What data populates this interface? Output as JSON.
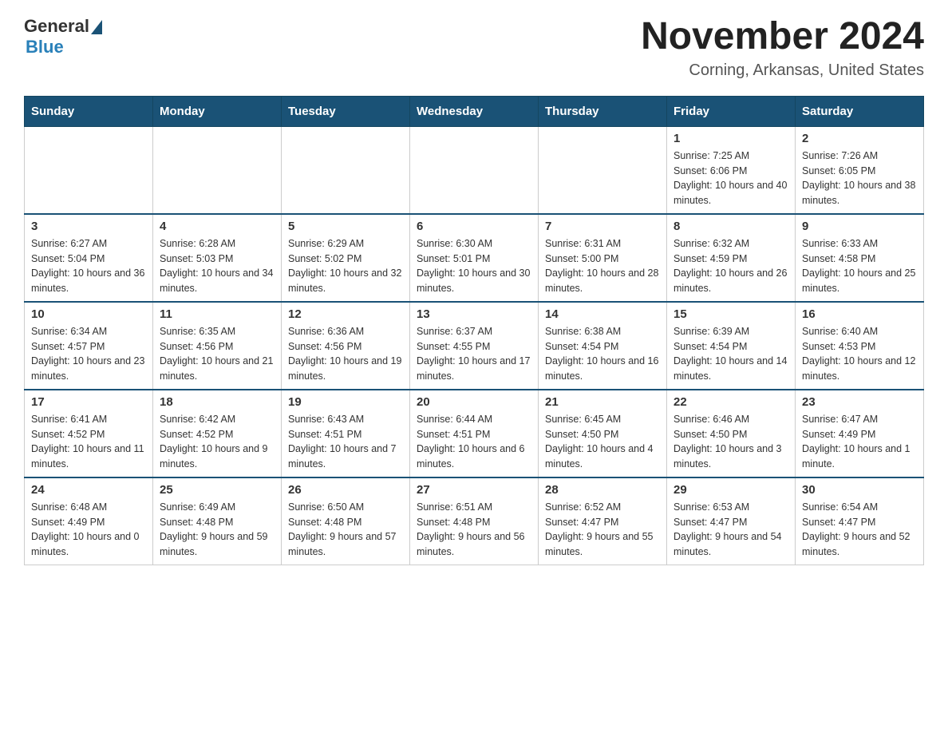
{
  "logo": {
    "general": "General",
    "blue": "Blue"
  },
  "title": "November 2024",
  "subtitle": "Corning, Arkansas, United States",
  "days_of_week": [
    "Sunday",
    "Monday",
    "Tuesday",
    "Wednesday",
    "Thursday",
    "Friday",
    "Saturday"
  ],
  "weeks": [
    [
      {
        "day": "",
        "info": ""
      },
      {
        "day": "",
        "info": ""
      },
      {
        "day": "",
        "info": ""
      },
      {
        "day": "",
        "info": ""
      },
      {
        "day": "",
        "info": ""
      },
      {
        "day": "1",
        "info": "Sunrise: 7:25 AM\nSunset: 6:06 PM\nDaylight: 10 hours and 40 minutes."
      },
      {
        "day": "2",
        "info": "Sunrise: 7:26 AM\nSunset: 6:05 PM\nDaylight: 10 hours and 38 minutes."
      }
    ],
    [
      {
        "day": "3",
        "info": "Sunrise: 6:27 AM\nSunset: 5:04 PM\nDaylight: 10 hours and 36 minutes."
      },
      {
        "day": "4",
        "info": "Sunrise: 6:28 AM\nSunset: 5:03 PM\nDaylight: 10 hours and 34 minutes."
      },
      {
        "day": "5",
        "info": "Sunrise: 6:29 AM\nSunset: 5:02 PM\nDaylight: 10 hours and 32 minutes."
      },
      {
        "day": "6",
        "info": "Sunrise: 6:30 AM\nSunset: 5:01 PM\nDaylight: 10 hours and 30 minutes."
      },
      {
        "day": "7",
        "info": "Sunrise: 6:31 AM\nSunset: 5:00 PM\nDaylight: 10 hours and 28 minutes."
      },
      {
        "day": "8",
        "info": "Sunrise: 6:32 AM\nSunset: 4:59 PM\nDaylight: 10 hours and 26 minutes."
      },
      {
        "day": "9",
        "info": "Sunrise: 6:33 AM\nSunset: 4:58 PM\nDaylight: 10 hours and 25 minutes."
      }
    ],
    [
      {
        "day": "10",
        "info": "Sunrise: 6:34 AM\nSunset: 4:57 PM\nDaylight: 10 hours and 23 minutes."
      },
      {
        "day": "11",
        "info": "Sunrise: 6:35 AM\nSunset: 4:56 PM\nDaylight: 10 hours and 21 minutes."
      },
      {
        "day": "12",
        "info": "Sunrise: 6:36 AM\nSunset: 4:56 PM\nDaylight: 10 hours and 19 minutes."
      },
      {
        "day": "13",
        "info": "Sunrise: 6:37 AM\nSunset: 4:55 PM\nDaylight: 10 hours and 17 minutes."
      },
      {
        "day": "14",
        "info": "Sunrise: 6:38 AM\nSunset: 4:54 PM\nDaylight: 10 hours and 16 minutes."
      },
      {
        "day": "15",
        "info": "Sunrise: 6:39 AM\nSunset: 4:54 PM\nDaylight: 10 hours and 14 minutes."
      },
      {
        "day": "16",
        "info": "Sunrise: 6:40 AM\nSunset: 4:53 PM\nDaylight: 10 hours and 12 minutes."
      }
    ],
    [
      {
        "day": "17",
        "info": "Sunrise: 6:41 AM\nSunset: 4:52 PM\nDaylight: 10 hours and 11 minutes."
      },
      {
        "day": "18",
        "info": "Sunrise: 6:42 AM\nSunset: 4:52 PM\nDaylight: 10 hours and 9 minutes."
      },
      {
        "day": "19",
        "info": "Sunrise: 6:43 AM\nSunset: 4:51 PM\nDaylight: 10 hours and 7 minutes."
      },
      {
        "day": "20",
        "info": "Sunrise: 6:44 AM\nSunset: 4:51 PM\nDaylight: 10 hours and 6 minutes."
      },
      {
        "day": "21",
        "info": "Sunrise: 6:45 AM\nSunset: 4:50 PM\nDaylight: 10 hours and 4 minutes."
      },
      {
        "day": "22",
        "info": "Sunrise: 6:46 AM\nSunset: 4:50 PM\nDaylight: 10 hours and 3 minutes."
      },
      {
        "day": "23",
        "info": "Sunrise: 6:47 AM\nSunset: 4:49 PM\nDaylight: 10 hours and 1 minute."
      }
    ],
    [
      {
        "day": "24",
        "info": "Sunrise: 6:48 AM\nSunset: 4:49 PM\nDaylight: 10 hours and 0 minutes."
      },
      {
        "day": "25",
        "info": "Sunrise: 6:49 AM\nSunset: 4:48 PM\nDaylight: 9 hours and 59 minutes."
      },
      {
        "day": "26",
        "info": "Sunrise: 6:50 AM\nSunset: 4:48 PM\nDaylight: 9 hours and 57 minutes."
      },
      {
        "day": "27",
        "info": "Sunrise: 6:51 AM\nSunset: 4:48 PM\nDaylight: 9 hours and 56 minutes."
      },
      {
        "day": "28",
        "info": "Sunrise: 6:52 AM\nSunset: 4:47 PM\nDaylight: 9 hours and 55 minutes."
      },
      {
        "day": "29",
        "info": "Sunrise: 6:53 AM\nSunset: 4:47 PM\nDaylight: 9 hours and 54 minutes."
      },
      {
        "day": "30",
        "info": "Sunrise: 6:54 AM\nSunset: 4:47 PM\nDaylight: 9 hours and 52 minutes."
      }
    ]
  ]
}
